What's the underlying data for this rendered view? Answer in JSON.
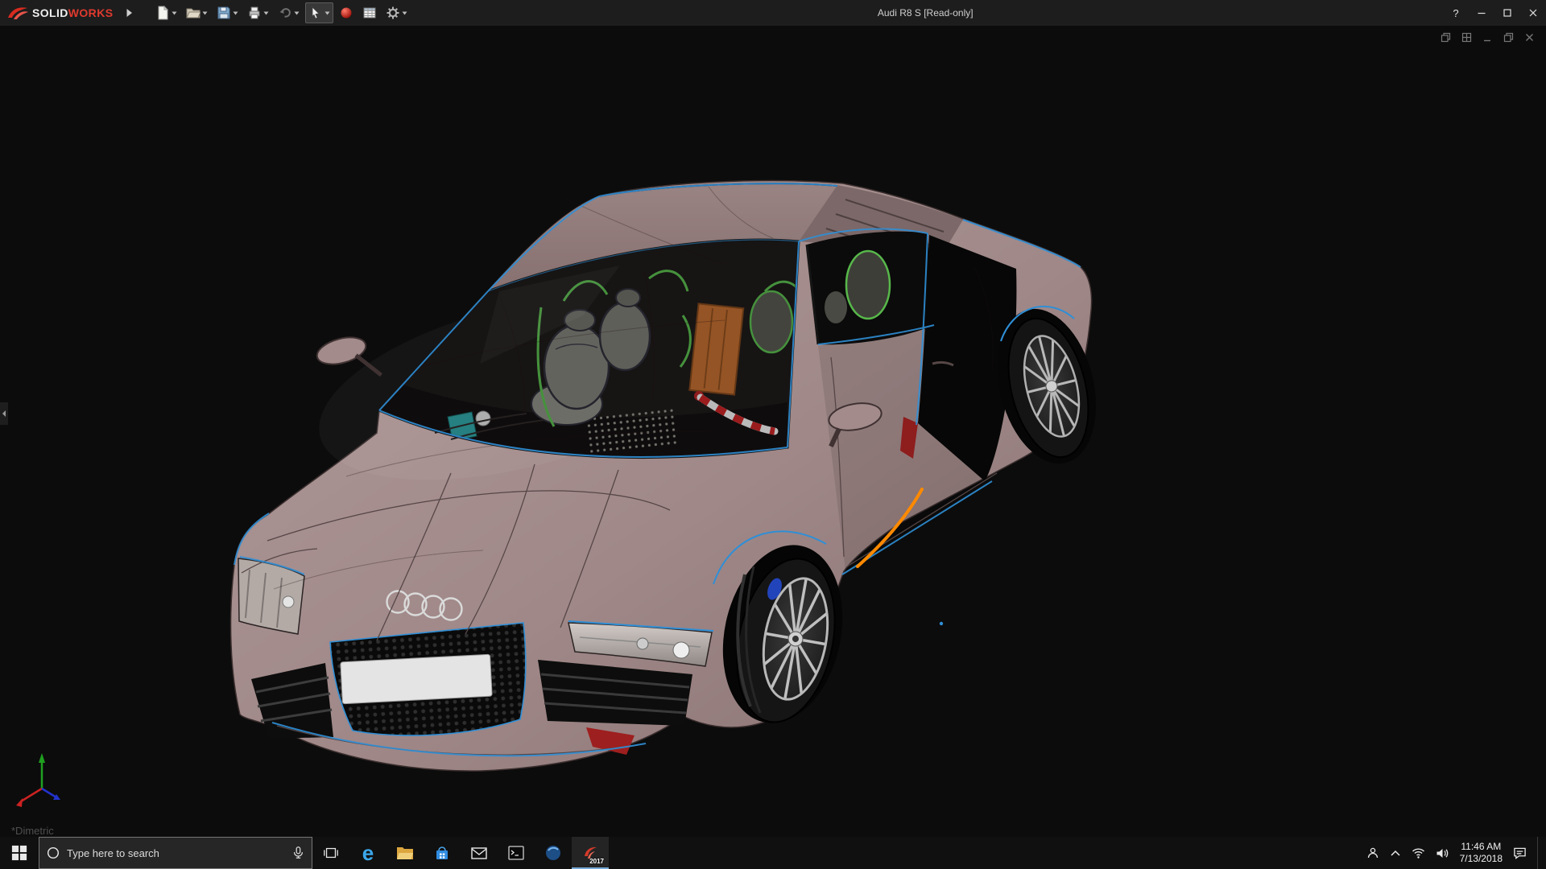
{
  "app": {
    "brand_solid": "SOLID",
    "brand_works": "WORKS",
    "title": "Audi R8 S [Read-only]",
    "help_glyph": "?"
  },
  "toolbar": {
    "tools": [
      {
        "name": "new-document"
      },
      {
        "name": "open"
      },
      {
        "name": "save"
      },
      {
        "name": "print"
      },
      {
        "name": "undo"
      },
      {
        "name": "select-cursor",
        "active": true
      },
      {
        "name": "red-status"
      },
      {
        "name": "design-table"
      },
      {
        "name": "options-gear"
      }
    ]
  },
  "viewport": {
    "view_label": "*Dimetric",
    "doc_window_controls": [
      "cascade",
      "tile",
      "minimize",
      "restore",
      "close"
    ]
  },
  "taskbar": {
    "search_placeholder": "Type here to search",
    "edge_letter": "e",
    "sw_year": "2017",
    "time": "11:46 AM",
    "date": "7/13/2018"
  },
  "colors": {
    "titlebar_bg": "#1d1d1d",
    "viewport_bg": "#0c0c0c",
    "taskbar_bg": "#101010",
    "car_body": "#a08888",
    "edge_highlight_blue": "#2f8fd6",
    "selected_edge_orange": "#ff8a00",
    "interior_green": "#57b84a",
    "brand_red": "#d92b1f"
  }
}
